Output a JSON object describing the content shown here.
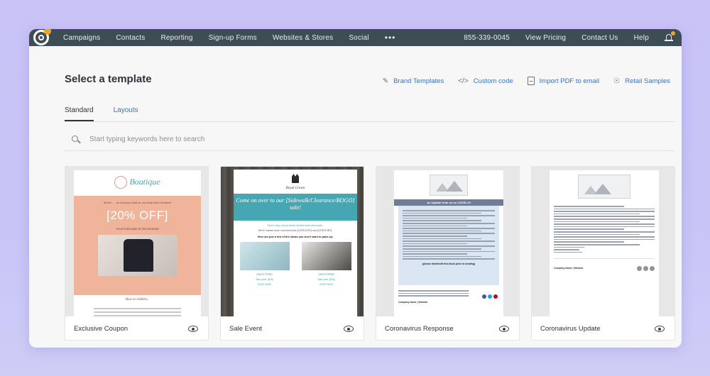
{
  "nav": {
    "items": [
      "Campaigns",
      "Contacts",
      "Reporting",
      "Sign-up Forms",
      "Websites & Stores",
      "Social"
    ],
    "more": "•••",
    "phone": "855-339-0045",
    "right_items": [
      "View Pricing",
      "Contact Us",
      "Help"
    ]
  },
  "page": {
    "title": "Select a template",
    "actions": [
      {
        "label": "Brand Templates",
        "icon": "brush-icon"
      },
      {
        "label": "Custom code",
        "icon": "code-icon"
      },
      {
        "label": "Import PDF to email",
        "icon": "pdf-icon"
      },
      {
        "label": "Retail Samples",
        "icon": "lightbulb-icon"
      }
    ],
    "tabs": [
      {
        "label": "Standard",
        "active": true
      },
      {
        "label": "Layouts",
        "active": false
      }
    ]
  },
  "search": {
    "placeholder": "Start typing keywords here to search",
    "value": ""
  },
  "cards": [
    {
      "title": "Exclusive Coupon",
      "preview": {
        "brand": "Boutique",
        "intro": "Shhhh...... an exclusive deal for our email club members!",
        "offer": "[20% OFF]",
        "sub": "YOUR PURCHASE OF $75 OR MORE",
        "redeem": "How to redeem..."
      }
    },
    {
      "title": "Sale Event",
      "preview": {
        "brand": "Royal Crown",
        "headline": "Come on over to our [Sidewalk/Clearance/BOGO] sale!",
        "note": "Don't miss out on these limited-time discounts.",
        "line": "We've marked down most items like [CATEGORY] and [CATEGORY].",
        "steals": "Here are just a few of the steals you won't want to pass up:",
        "item_label": "[SALE ITEM]",
        "price": "Sale price: [$15]",
        "button": "SHOP NOW"
      }
    },
    {
      "title": "Coronavirus Response",
      "preview": {
        "banner": "An Update from us on COVID-19",
        "callout": "(please delete/edit this block prior to sending)",
        "company": "Company Name | Website"
      }
    },
    {
      "title": "Coronavirus Update",
      "preview": {
        "company": "Company Name | Website"
      }
    }
  ],
  "colors": {
    "nav_bg": "#3e4c55",
    "link": "#3b72b1",
    "accent_orange": "#f0a51e",
    "background": "#c9c3f7"
  }
}
